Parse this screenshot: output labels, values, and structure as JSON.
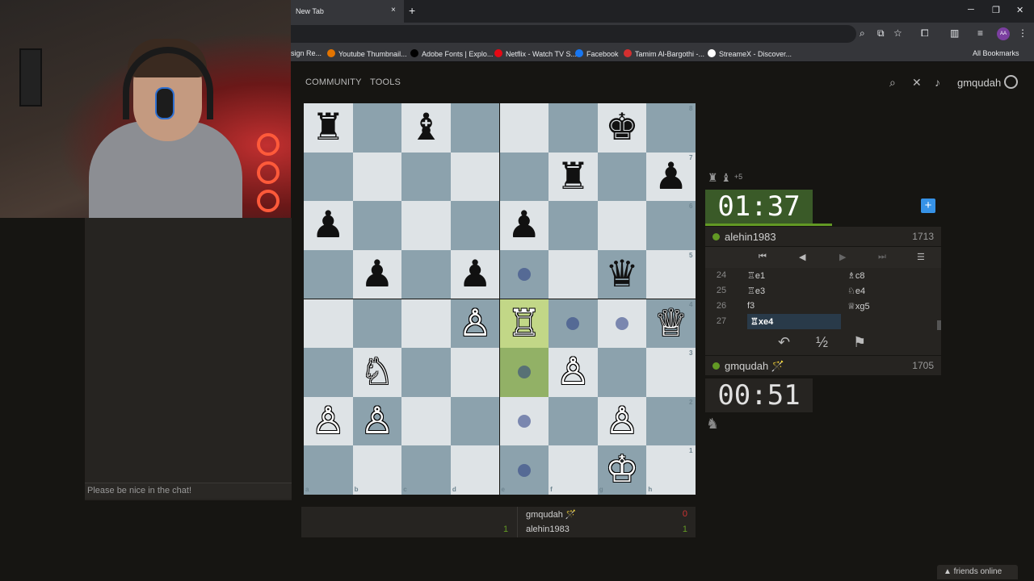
{
  "browser": {
    "tab_title": "New Tab",
    "tab_close": "×",
    "new_tab": "+",
    "window_controls": [
      "─",
      "❐",
      "✕"
    ],
    "profile_initials": "AA",
    "bookmarks": [
      {
        "label": "sign Re...",
        "icon_color": ""
      },
      {
        "label": "Youtube Thumbnail...",
        "icon_color": "#e37400"
      },
      {
        "label": "Adobe Fonts | Explo...",
        "icon_color": "#000000"
      },
      {
        "label": "Netflix - Watch TV S...",
        "icon_color": "#e50914"
      },
      {
        "label": "Facebook",
        "icon_color": "#1877f2"
      },
      {
        "label": "Tamim Al-Bargothi -...",
        "icon_color": "#d32f2f"
      },
      {
        "label": "StreameX - Discover...",
        "icon_color": "#ffffff"
      }
    ],
    "all_bookmarks": "All Bookmarks"
  },
  "nav": {
    "community": "COMMUNITY",
    "tools": "TOOLS",
    "username": "gmqudah"
  },
  "chat": {
    "placeholder": "Please be nice in the chat!"
  },
  "board": {
    "files": [
      "a",
      "b",
      "c",
      "d",
      "e",
      "f",
      "g",
      "h"
    ],
    "ranks": [
      "8",
      "7",
      "6",
      "5",
      "4",
      "3",
      "2",
      "1"
    ],
    "pieces": [
      {
        "glyph": "♜",
        "color": "black",
        "square": "a8"
      },
      {
        "glyph": "♝",
        "color": "black",
        "square": "c8"
      },
      {
        "glyph": "♚",
        "color": "black",
        "square": "g8"
      },
      {
        "glyph": "♜",
        "color": "black",
        "square": "f7"
      },
      {
        "glyph": "♟",
        "color": "black",
        "square": "h7"
      },
      {
        "glyph": "♟",
        "color": "black",
        "square": "a6"
      },
      {
        "glyph": "♟",
        "color": "black",
        "square": "e6"
      },
      {
        "glyph": "♟",
        "color": "black",
        "square": "b5"
      },
      {
        "glyph": "♟",
        "color": "black",
        "square": "d5"
      },
      {
        "glyph": "♛",
        "color": "black",
        "square": "g5"
      },
      {
        "glyph": "♙",
        "color": "white",
        "square": "d4"
      },
      {
        "glyph": "♖",
        "color": "white",
        "square": "e4"
      },
      {
        "glyph": "♕",
        "color": "white",
        "square": "h4"
      },
      {
        "glyph": "♘",
        "color": "white",
        "square": "b3"
      },
      {
        "glyph": "♙",
        "color": "white",
        "square": "f3"
      },
      {
        "glyph": "♙",
        "color": "white",
        "square": "a2"
      },
      {
        "glyph": "♙",
        "color": "white",
        "square": "b2"
      },
      {
        "glyph": "♙",
        "color": "white",
        "square": "g2"
      },
      {
        "glyph": "♔",
        "color": "white",
        "square": "g1"
      }
    ],
    "highlights": [
      "e4",
      "e3"
    ],
    "move_dots": [
      "e5",
      "f4",
      "g4",
      "e3",
      "e2",
      "e1"
    ]
  },
  "right_panel": {
    "captured": "♜ ♝",
    "captured_diff": "+5",
    "top_clock": "01:37",
    "bottom_clock": "00:51",
    "top_clock_remaining": 0.55,
    "opponent": {
      "name": "alehin1983",
      "rating": "1713"
    },
    "me": {
      "name": "gmqudah 🪄",
      "rating": "1705"
    },
    "controls": [
      "⏮",
      "◀",
      "▶",
      "⏭",
      "☰"
    ],
    "moves": [
      {
        "num": "24",
        "white": "♖e1",
        "black": "♗c8"
      },
      {
        "num": "25",
        "white": "♖e3",
        "black": "♘e4"
      },
      {
        "num": "26",
        "white": "f3",
        "black": "♕xg5"
      },
      {
        "num": "27",
        "white": "♖xe4",
        "black": ""
      }
    ],
    "actions": [
      "↶",
      "½",
      "⚑"
    ]
  },
  "score": {
    "player1": "gmqudah 🪄",
    "player1_left": "",
    "player1_right": "0",
    "player2": "alehin1983",
    "player2_left": "1",
    "player2_right": "1"
  },
  "footer": {
    "friends": "▲ friends online"
  },
  "colors": {
    "accent_green": "#629924",
    "light_square": "#dee3e6",
    "dark_square": "#8ca2ad",
    "score_red": "#cc3333"
  }
}
